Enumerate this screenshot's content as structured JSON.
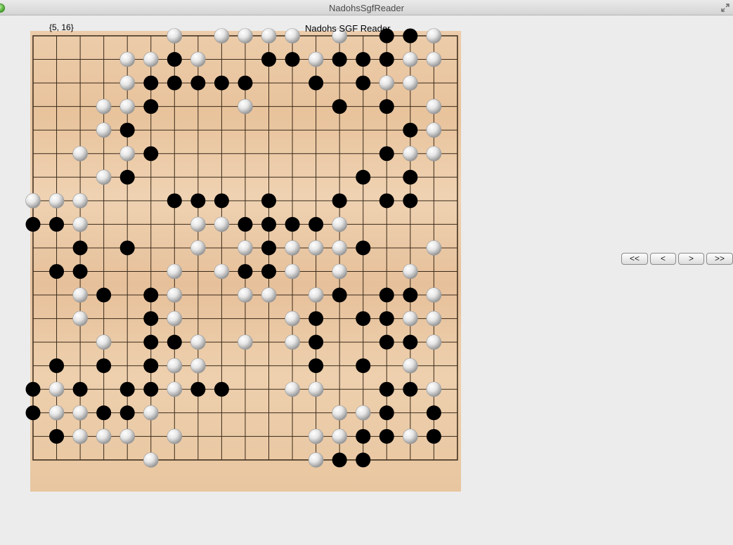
{
  "window": {
    "title": "NadohsSgfReader"
  },
  "header": {
    "coordinate_readout": "{5, 16}",
    "board_title": "Nadohs SGF Reader"
  },
  "navigation": {
    "first_label": "<<",
    "prev_label": "<",
    "next_label": ">",
    "last_label": ">>"
  },
  "board": {
    "size": 19,
    "colors": {
      "wood": "#ecc9a0",
      "grid": "#3a2a1a",
      "black_stone": "#000000",
      "white_stone": "#d8d8d8"
    },
    "stones": {
      "black": [
        [
          15,
          0
        ],
        [
          16,
          0
        ],
        [
          6,
          1
        ],
        [
          10,
          1
        ],
        [
          11,
          1
        ],
        [
          13,
          1
        ],
        [
          14,
          1
        ],
        [
          15,
          1
        ],
        [
          5,
          2
        ],
        [
          6,
          2
        ],
        [
          7,
          2
        ],
        [
          8,
          2
        ],
        [
          9,
          2
        ],
        [
          12,
          2
        ],
        [
          14,
          2
        ],
        [
          5,
          3
        ],
        [
          13,
          3
        ],
        [
          15,
          3
        ],
        [
          4,
          4
        ],
        [
          16,
          4
        ],
        [
          5,
          5
        ],
        [
          15,
          5
        ],
        [
          4,
          6
        ],
        [
          14,
          6
        ],
        [
          16,
          6
        ],
        [
          6,
          7
        ],
        [
          7,
          7
        ],
        [
          8,
          7
        ],
        [
          10,
          7
        ],
        [
          13,
          7
        ],
        [
          15,
          7
        ],
        [
          16,
          7
        ],
        [
          0,
          8
        ],
        [
          1,
          8
        ],
        [
          9,
          8
        ],
        [
          10,
          8
        ],
        [
          11,
          8
        ],
        [
          12,
          8
        ],
        [
          2,
          9
        ],
        [
          4,
          9
        ],
        [
          10,
          9
        ],
        [
          14,
          9
        ],
        [
          1,
          10
        ],
        [
          2,
          10
        ],
        [
          9,
          10
        ],
        [
          10,
          10
        ],
        [
          3,
          11
        ],
        [
          5,
          11
        ],
        [
          13,
          11
        ],
        [
          15,
          11
        ],
        [
          16,
          11
        ],
        [
          5,
          12
        ],
        [
          12,
          12
        ],
        [
          14,
          12
        ],
        [
          15,
          12
        ],
        [
          5,
          13
        ],
        [
          6,
          13
        ],
        [
          12,
          13
        ],
        [
          15,
          13
        ],
        [
          16,
          13
        ],
        [
          1,
          14
        ],
        [
          3,
          14
        ],
        [
          5,
          14
        ],
        [
          12,
          14
        ],
        [
          14,
          14
        ],
        [
          0,
          15
        ],
        [
          2,
          15
        ],
        [
          4,
          15
        ],
        [
          5,
          15
        ],
        [
          7,
          15
        ],
        [
          8,
          15
        ],
        [
          15,
          15
        ],
        [
          16,
          15
        ],
        [
          0,
          16
        ],
        [
          3,
          16
        ],
        [
          4,
          16
        ],
        [
          15,
          16
        ],
        [
          17,
          16
        ],
        [
          1,
          17
        ],
        [
          14,
          17
        ],
        [
          15,
          17
        ],
        [
          17,
          17
        ],
        [
          13,
          18
        ],
        [
          14,
          18
        ]
      ],
      "white": [
        [
          6,
          0
        ],
        [
          8,
          0
        ],
        [
          9,
          0
        ],
        [
          10,
          0
        ],
        [
          11,
          0
        ],
        [
          13,
          0
        ],
        [
          17,
          0
        ],
        [
          4,
          1
        ],
        [
          5,
          1
        ],
        [
          7,
          1
        ],
        [
          12,
          1
        ],
        [
          16,
          1
        ],
        [
          17,
          1
        ],
        [
          4,
          2
        ],
        [
          15,
          2
        ],
        [
          16,
          2
        ],
        [
          3,
          3
        ],
        [
          4,
          3
        ],
        [
          9,
          3
        ],
        [
          17,
          3
        ],
        [
          3,
          4
        ],
        [
          17,
          4
        ],
        [
          2,
          5
        ],
        [
          4,
          5
        ],
        [
          16,
          5
        ],
        [
          17,
          5
        ],
        [
          3,
          6
        ],
        [
          0,
          7
        ],
        [
          1,
          7
        ],
        [
          2,
          7
        ],
        [
          2,
          8
        ],
        [
          7,
          8
        ],
        [
          8,
          8
        ],
        [
          13,
          8
        ],
        [
          7,
          9
        ],
        [
          9,
          9
        ],
        [
          11,
          9
        ],
        [
          12,
          9
        ],
        [
          13,
          9
        ],
        [
          17,
          9
        ],
        [
          6,
          10
        ],
        [
          8,
          10
        ],
        [
          11,
          10
        ],
        [
          13,
          10
        ],
        [
          16,
          10
        ],
        [
          2,
          11
        ],
        [
          6,
          11
        ],
        [
          9,
          11
        ],
        [
          10,
          11
        ],
        [
          12,
          11
        ],
        [
          17,
          11
        ],
        [
          2,
          12
        ],
        [
          6,
          12
        ],
        [
          11,
          12
        ],
        [
          16,
          12
        ],
        [
          17,
          12
        ],
        [
          3,
          13
        ],
        [
          7,
          13
        ],
        [
          9,
          13
        ],
        [
          11,
          13
        ],
        [
          17,
          13
        ],
        [
          6,
          14
        ],
        [
          7,
          14
        ],
        [
          16,
          14
        ],
        [
          1,
          15
        ],
        [
          6,
          15
        ],
        [
          11,
          15
        ],
        [
          12,
          15
        ],
        [
          17,
          15
        ],
        [
          1,
          16
        ],
        [
          2,
          16
        ],
        [
          5,
          16
        ],
        [
          13,
          16
        ],
        [
          14,
          16
        ],
        [
          2,
          17
        ],
        [
          3,
          17
        ],
        [
          4,
          17
        ],
        [
          6,
          17
        ],
        [
          12,
          17
        ],
        [
          13,
          17
        ],
        [
          16,
          17
        ],
        [
          5,
          18
        ],
        [
          12,
          18
        ]
      ]
    }
  }
}
